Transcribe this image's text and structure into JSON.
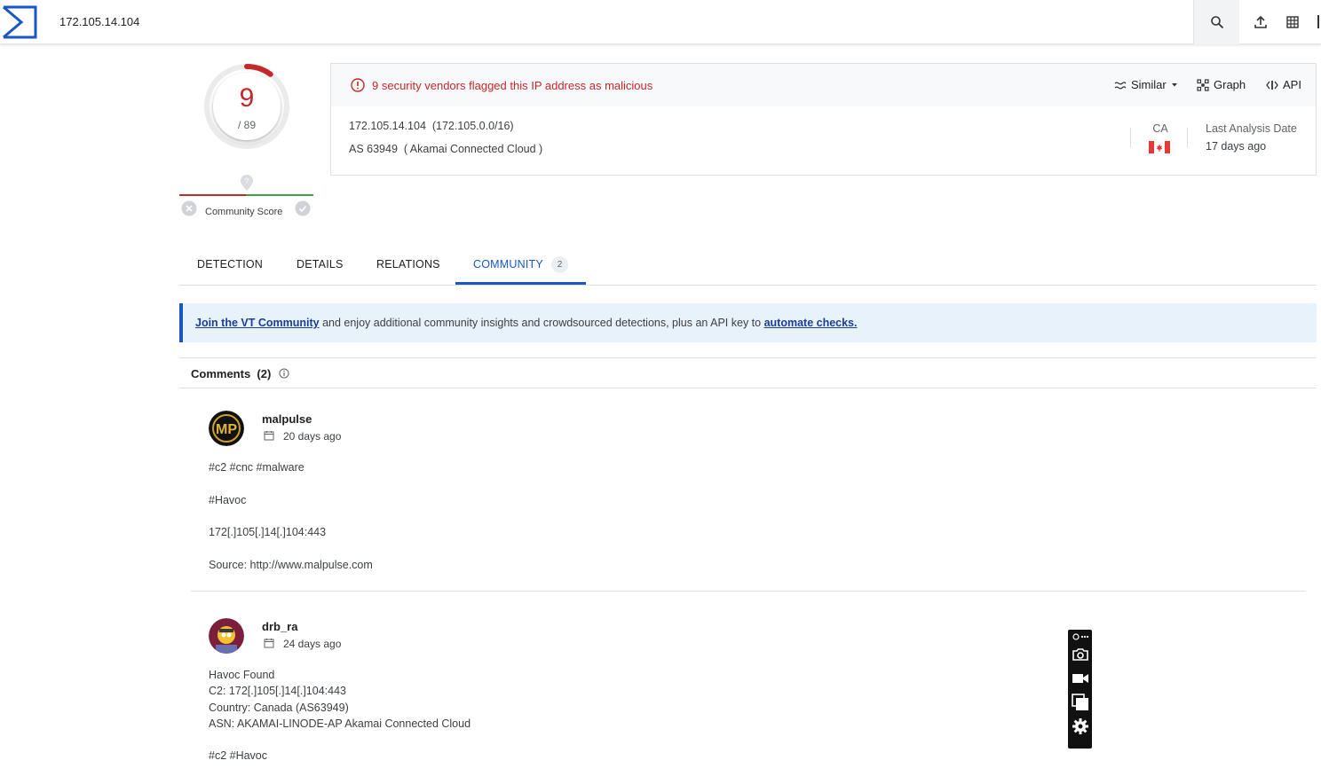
{
  "topbar": {
    "search_value": "172.105.14.104"
  },
  "score": {
    "detections": "9",
    "total": "/ 89",
    "detection_fraction": 0.101,
    "community_label": "Community Score"
  },
  "header": {
    "alert_text": "9 security vendors flagged this IP address as malicious",
    "actions": {
      "similar": "Similar",
      "graph": "Graph",
      "api": "API"
    },
    "ip_line": "172.105.14.104  (172.105.0.0/16)",
    "as_line": "AS 63949  ( Akamai Connected Cloud )",
    "country_code": "CA",
    "last_analysis_label": "Last Analysis Date",
    "last_analysis_value": "17 days ago"
  },
  "tabs": [
    {
      "label": "DETECTION"
    },
    {
      "label": "DETAILS"
    },
    {
      "label": "RELATIONS"
    },
    {
      "label": "COMMUNITY",
      "count": "2",
      "active": true
    }
  ],
  "banner": {
    "link1": "Join the VT Community",
    "middle": " and enjoy additional community insights and crowdsourced detections, plus an API key to ",
    "link2": "automate checks."
  },
  "comments": {
    "title": "Comments",
    "count": "(2)",
    "items": [
      {
        "author": "malpulse",
        "date": "20 days ago",
        "lines": [
          "#c2 #cnc #malware",
          "#Havoc",
          "172[.]105[.]14[.]104:443",
          "Source: http://www.malpulse.com"
        ]
      },
      {
        "author": "drb_ra",
        "date": "24 days ago",
        "lines": [
          "Havoc Found",
          "C2: 172[.]105[.]14[.]104:443",
          "Country: Canada (AS63949)",
          "ASN: AKAMAI-LINODE-AP Akamai Connected Cloud",
          "#c2 #Havoc"
        ]
      }
    ]
  },
  "colors": {
    "malicious": "#c62828",
    "accent": "#1a56c4",
    "banner_bg": "#e8f2fb"
  },
  "icons": [
    "virustotal-logo",
    "search-icon",
    "upload-icon",
    "grid-icon",
    "alert-icon",
    "similar-icon",
    "graph-icon",
    "api-icon",
    "canada-flag",
    "calendar-icon",
    "info-icon",
    "camera-icon",
    "video-icon",
    "window-icon",
    "gear-icon"
  ]
}
